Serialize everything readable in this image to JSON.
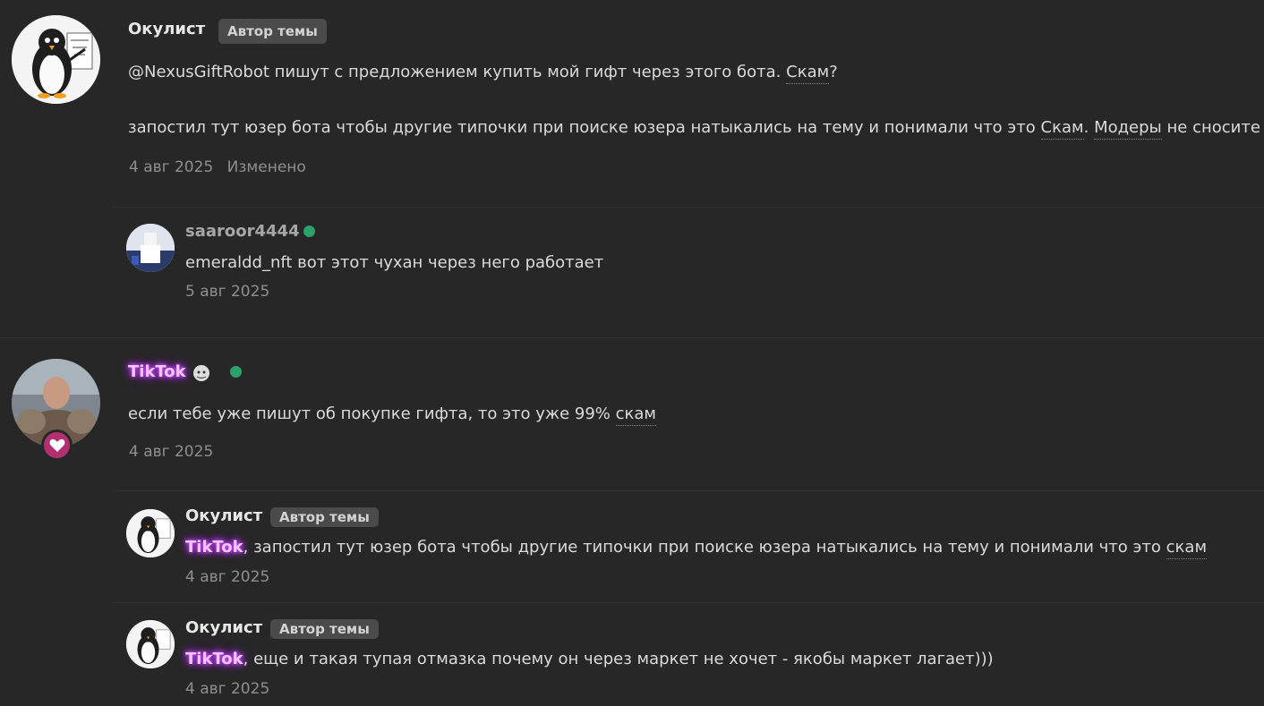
{
  "post1": {
    "author": "Окулист",
    "badge": "Автор темы",
    "text_prefix": "@NexusGiftRobot пишут с предложением купить мой гифт через этого бота.",
    "text_link": "Скам",
    "text_suffix": "?",
    "line2_prefix": "запостил тут юзер бота чтобы другие типочки при поиске юзера натыкались на тему и понимали что это",
    "line2_link1": "Скам",
    "line2_mid": ".",
    "line2_link2": "Модеры",
    "line2_suffix": "не сносите",
    "date": "4 авг 2025",
    "edited": "Изменено"
  },
  "reply1": {
    "author": "saaroor4444",
    "text": "emeraldd_nft вот этот чухан через него работает",
    "date": "5 авг 2025"
  },
  "post2": {
    "author": "TikTok",
    "text_prefix": "если тебе уже пишут об покупке гифта, то это уже 99%",
    "text_link": "скам",
    "date": "4 авг 2025"
  },
  "reply2": {
    "author": "Окулист",
    "badge": "Автор темы",
    "mention": "TikTok",
    "text_prefix": ", запостил тут юзер бота чтобы другие типочки при поиске юзера натыкались на тему и понимали что это",
    "text_link": "скам",
    "date": "4 авг 2025"
  },
  "reply3": {
    "author": "Окулист",
    "badge": "Автор темы",
    "mention": "TikTok",
    "text": ", еще и такая тупая отмазка почему он через маркет не хочет - якобы маркет лагает)))",
    "date": "4 авг 2025"
  },
  "colors": {
    "background": "#272727",
    "online": "#29a36a",
    "heart_badge": "#b2306f",
    "tiktok_glow": "#c43cff"
  }
}
